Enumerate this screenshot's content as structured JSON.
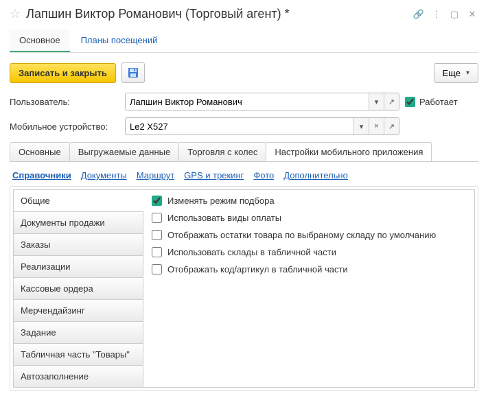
{
  "header": {
    "title": "Лапшин Виктор Романович (Торговый агент) *"
  },
  "nav": {
    "main": "Основное",
    "plans": "Планы посещений"
  },
  "toolbar": {
    "save_close": "Записать и закрыть",
    "more": "Еще"
  },
  "fields": {
    "user_label": "Пользователь:",
    "user_value": "Лапшин Виктор Романович",
    "works_label": "Работает",
    "device_label": "Мобильное устройство:",
    "device_value": "Le2 X527"
  },
  "tabs": {
    "t1": "Основные",
    "t2": "Выгружаемые данные",
    "t3": "Торговля с колес",
    "t4": "Настройки мобильного приложения"
  },
  "subtabs": {
    "s1": "Справочники",
    "s2": "Документы",
    "s3": "Маршрут",
    "s4": "GPS и трекинг",
    "s5": "Фото",
    "s6": "Дополнительно"
  },
  "vtabs": {
    "v1": "Общие",
    "v2": "Документы продажи",
    "v3": "Заказы",
    "v4": "Реализации",
    "v5": "Кассовые ордера",
    "v6": "Мерчендайзинг",
    "v7": "Задание",
    "v8": "Табличная часть \"Товары\"",
    "v9": "Автозаполнение"
  },
  "options": {
    "o1": "Изменять режим подбора",
    "o2": "Использовать виды оплаты",
    "o3": "Отображать остатки товара по выбраному складу по умолчанию",
    "o4": "Использовать склады в табличной части",
    "o5": "Отображать код/артикул в табличной части"
  }
}
